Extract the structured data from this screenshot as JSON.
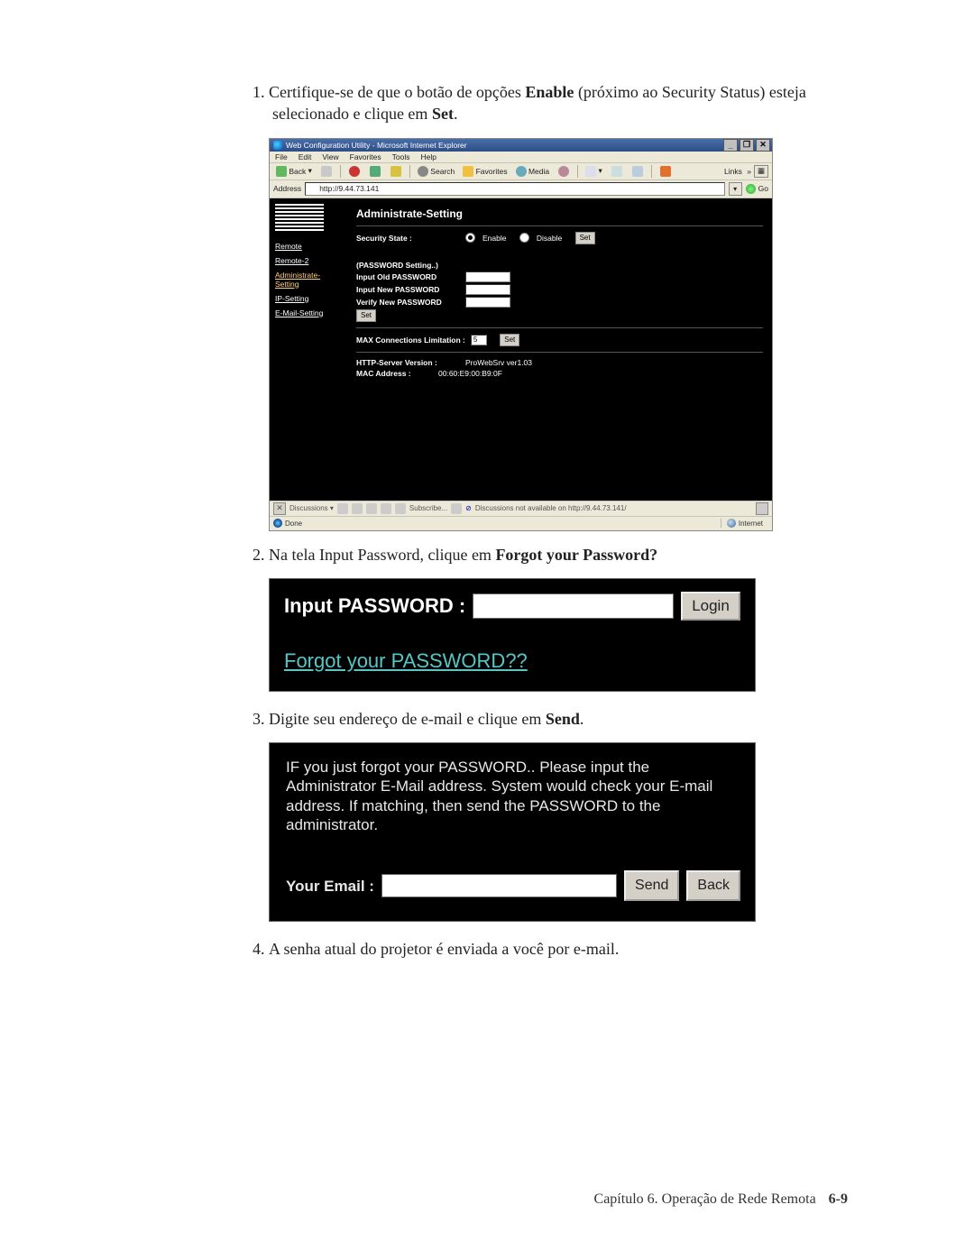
{
  "steps": {
    "s1_pre": "Certifique-se de que o botão de opções ",
    "s1_b1": "Enable",
    "s1_mid": " (próximo ao Security Status) esteja selecionado e clique em ",
    "s1_b2": "Set",
    "s1_post": ".",
    "s2_pre": "Na tela Input Password, clique em ",
    "s2_b1": "Forgot your Password?",
    "s3_pre": "Digite seu endereço de e-mail e clique em ",
    "s3_b1": "Send",
    "s3_post": ".",
    "s4": "A senha atual do projetor é enviada a você por e-mail."
  },
  "ie": {
    "title": "Web Configuration Utility - Microsoft Internet Explorer",
    "menu": {
      "file": "File",
      "edit": "Edit",
      "view": "View",
      "favorites": "Favorites",
      "tools": "Tools",
      "help": "Help"
    },
    "toolbar": {
      "back": "Back",
      "search": "Search",
      "favorites": "Favorites",
      "media": "Media",
      "links": "Links"
    },
    "address_label": "Address",
    "address_value": "http://9.44.73.141",
    "go": "Go",
    "sidebar": {
      "items": [
        {
          "label": "Remote"
        },
        {
          "label": "Remote-2"
        },
        {
          "label": "Administrate-Setting"
        },
        {
          "label": "IP-Setting"
        },
        {
          "label": "E-Mail-Setting"
        }
      ]
    },
    "main": {
      "heading": "Administrate-Setting",
      "sec_state_label": "Security State :",
      "enable": "Enable",
      "disable": "Disable",
      "set": "Set",
      "pw_setting": "(PASSWORD Setting..)",
      "old_pw": "Input Old PASSWORD",
      "new_pw": "Input New PASSWORD",
      "ver_pw": "Verify New PASSWORD",
      "max_conn_label": "MAX Connections Limitation :",
      "max_conn_value": "5",
      "http_label": "HTTP-Server Version :",
      "http_value": "ProWebSrv ver1.03",
      "mac_label": "MAC Address :",
      "mac_value": "00:60:E9:00:B9:0F"
    },
    "discuss": {
      "label": "Discussions ▾",
      "subscribe": "Subscribe...",
      "notavail": "Discussions not available on http://9.44.73.141/"
    },
    "status": {
      "done": "Done",
      "zone": "Internet"
    }
  },
  "login": {
    "label": "Input PASSWORD :",
    "button": "Login",
    "forgot": "Forgot your PASSWORD??"
  },
  "email": {
    "msg": "IF you just forgot your PASSWORD.. Please input the Administrator E-Mail address. System would check your E-mail address. If matching, then send the PASSWORD to the administrator.",
    "label": "Your Email :",
    "send": "Send",
    "back": "Back"
  },
  "footer": {
    "chapter": "Capítulo 6. Operação de Rede Remota",
    "page": "6-9"
  }
}
